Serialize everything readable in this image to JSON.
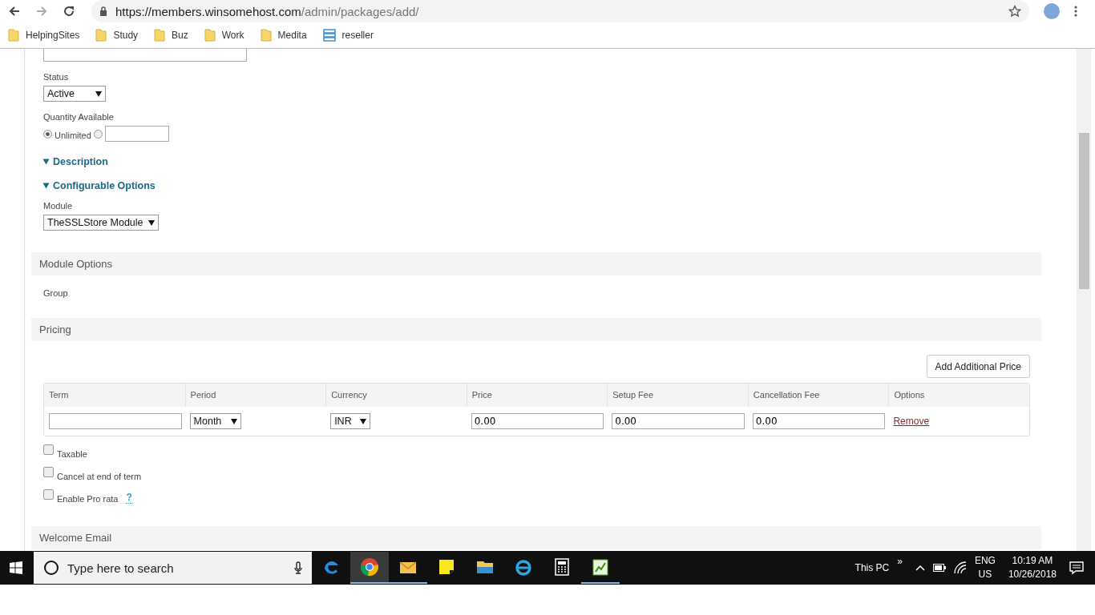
{
  "browser": {
    "url_host": "https://members.winsomehost.com",
    "url_path": "/admin/packages/add/",
    "bookmarks": [
      {
        "label": "HelpingSites",
        "kind": "folder"
      },
      {
        "label": "Study",
        "kind": "folder"
      },
      {
        "label": "Buz",
        "kind": "folder"
      },
      {
        "label": "Work",
        "kind": "folder"
      },
      {
        "label": "Medita",
        "kind": "folder"
      },
      {
        "label": "reseller",
        "kind": "stack"
      }
    ]
  },
  "form": {
    "status": {
      "label": "Status",
      "value": "Active"
    },
    "quantity": {
      "label": "Quantity Available",
      "unlimited_label": "Unlimited",
      "unlimited_selected": true
    },
    "sections": [
      {
        "title": "Description",
        "expanded": true
      },
      {
        "title": "Configurable Options",
        "expanded": true
      }
    ],
    "module": {
      "label": "Module",
      "value": "TheSSLStore Module"
    }
  },
  "module_options": {
    "title": "Module Options",
    "group_label": "Group"
  },
  "pricing": {
    "title": "Pricing",
    "add_button": "Add Additional Price",
    "columns": [
      "Term",
      "Period",
      "Currency",
      "Price",
      "Setup Fee",
      "Cancellation Fee",
      "Options"
    ],
    "rows": [
      {
        "period": "Month",
        "currency": "INR",
        "price": "0.00",
        "setup_fee": "0.00",
        "cancellation_fee": "0.00",
        "action": "Remove"
      }
    ],
    "checkboxes": [
      {
        "label": "Taxable",
        "checked": false
      },
      {
        "label": "Cancel at end of term",
        "checked": false
      },
      {
        "label": "Enable Pro rata",
        "checked": false,
        "help": "?"
      }
    ]
  },
  "welcome_email": {
    "title": "Welcome Email"
  },
  "taskbar": {
    "search_placeholder": "Type here to search",
    "apps": [
      {
        "kind": "edge",
        "running": false
      },
      {
        "kind": "chrome",
        "running": true
      },
      {
        "kind": "mail",
        "running": true
      },
      {
        "kind": "note",
        "running": false
      },
      {
        "kind": "files",
        "running": false
      },
      {
        "kind": "ie",
        "running": false
      },
      {
        "kind": "calc",
        "running": false
      },
      {
        "kind": "chart",
        "running": true
      }
    ],
    "tray_label": "This PC",
    "chevron": "»",
    "language": "ENG",
    "region": "US",
    "time": "10:19 AM",
    "date": "10/26/2018"
  }
}
